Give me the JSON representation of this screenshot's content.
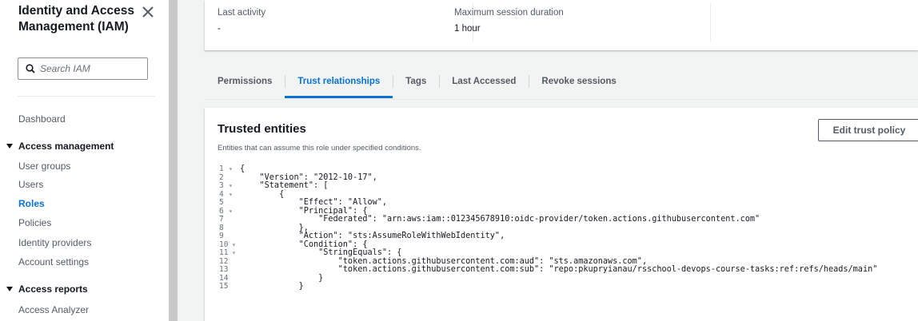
{
  "sidebar": {
    "title": "Identity and Access Management (IAM)",
    "search_placeholder": "Search IAM",
    "dashboard": "Dashboard",
    "access_management": {
      "label": "Access management",
      "items": [
        "User groups",
        "Users",
        "Roles",
        "Policies",
        "Identity providers",
        "Account settings"
      ],
      "active": "Roles"
    },
    "access_reports": {
      "label": "Access reports",
      "items": [
        "Access Analyzer"
      ]
    }
  },
  "summary": {
    "last_activity_label": "Last activity",
    "last_activity_value": "-",
    "max_session_label": "Maximum session duration",
    "max_session_value": "1 hour"
  },
  "tabs": [
    "Permissions",
    "Trust relationships",
    "Tags",
    "Last Accessed",
    "Revoke sessions"
  ],
  "active_tab": "Trust relationships",
  "trusted_entities": {
    "title": "Trusted entities",
    "description": "Entities that can assume this role under specified conditions.",
    "edit_button": "Edit trust policy"
  },
  "policy_lines": [
    {
      "n": "1",
      "fold": true,
      "text": "{"
    },
    {
      "n": "2",
      "fold": false,
      "text": "    \"Version\": \"2012-10-17\","
    },
    {
      "n": "3",
      "fold": true,
      "text": "    \"Statement\": ["
    },
    {
      "n": "4",
      "fold": true,
      "text": "        {"
    },
    {
      "n": "5",
      "fold": false,
      "text": "            \"Effect\": \"Allow\","
    },
    {
      "n": "6",
      "fold": true,
      "text": "            \"Principal\": {"
    },
    {
      "n": "7",
      "fold": false,
      "text": "                \"Federated\": \"arn:aws:iam::012345678910:oidc-provider/token.actions.githubusercontent.com\""
    },
    {
      "n": "8",
      "fold": false,
      "text": "            },"
    },
    {
      "n": "9",
      "fold": false,
      "text": "            \"Action\": \"sts:AssumeRoleWithWebIdentity\","
    },
    {
      "n": "10",
      "fold": true,
      "text": "            \"Condition\": {"
    },
    {
      "n": "11",
      "fold": true,
      "text": "                \"StringEquals\": {"
    },
    {
      "n": "12",
      "fold": false,
      "text": "                    \"token.actions.githubusercontent.com:aud\": \"sts.amazonaws.com\","
    },
    {
      "n": "13",
      "fold": false,
      "text": "                    \"token.actions.githubusercontent.com:sub\": \"repo:pkupryianau/rsschool-devops-course-tasks:ref:refs/heads/main\""
    },
    {
      "n": "14",
      "fold": false,
      "text": "                }"
    },
    {
      "n": "15",
      "fold": false,
      "text": "            }"
    }
  ],
  "colors": {
    "accent": "#0972d3",
    "background": "#f2f3f3",
    "code_text": "#1a3e8f"
  }
}
